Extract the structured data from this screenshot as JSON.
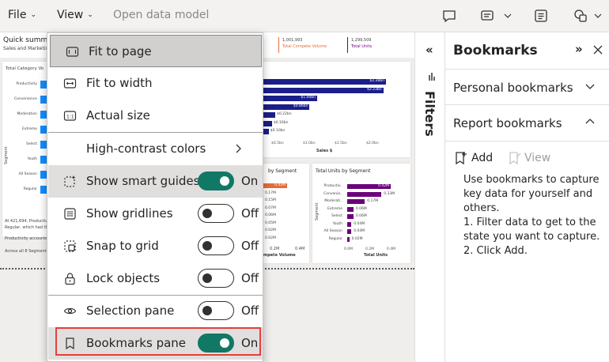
{
  "topbar": {
    "file_label": "File",
    "view_label": "View",
    "open_model_label": "Open data model"
  },
  "report": {
    "title": "Quick summar",
    "subtitle": "Sales and Marketin",
    "kpis": [
      {
        "value": "1,001,993",
        "label": "Total Compete Volume"
      },
      {
        "value": "1,299,509",
        "label": "Total Units"
      }
    ],
    "category_chart": {
      "title": "Total Category Vo",
      "ylabel": "Segment",
      "categories": [
        "Productivity",
        "Convenience",
        "Moderation",
        "Extreme",
        "Select",
        "Youth",
        "All Season",
        "Regular"
      ]
    },
    "sales_chart": {
      "bars": [
        {
          "label": "$2.28bn",
          "value": 2.28
        },
        {
          "label": "$2.23bn",
          "value": 2.23
        },
        {
          "label": "$1.00bn",
          "value": 1.0
        },
        {
          "label": "$0.86bn",
          "value": 0.86
        },
        {
          "label": "$0.22bn",
          "value": 0.22
        },
        {
          "label": "$0.16bn",
          "value": 0.16
        },
        {
          "label": "$0.10bn",
          "value": 0.1
        }
      ],
      "ticks": [
        "$0.5bn",
        "$1.0bn",
        "$1.5bn",
        "$2.0bn"
      ],
      "xlabel": "Sales $"
    },
    "compete_chart": {
      "title": "by Segment",
      "values": [
        "0.42M",
        "0.17M",
        "0.15M",
        "0.07M",
        "0.06M",
        "0.05M",
        "0.02M",
        "0.02M"
      ],
      "ticks": [
        "0.2M",
        "0.4M"
      ],
      "xlabel": "mpete Volume"
    },
    "units_chart": {
      "title": "Total Units by Segment",
      "ylabel": "Segment",
      "categories": [
        "Productiv..",
        "Convenie..",
        "Moderati..",
        "Extreme",
        "Select",
        "Youth",
        "All Season",
        "Regular"
      ],
      "values": [
        "0.42M",
        "0.33M",
        "0.17M",
        "0.06M",
        "0.06M",
        "0.04M",
        "0.04M",
        "0.02M"
      ],
      "ticks": [
        "0.0M",
        "0.2M",
        "0.4M"
      ],
      "xlabel": "Total Units"
    },
    "notes": [
      "At 421,694, Productiv",
      "Regular, which had the",
      "Productivity accounte",
      "Across all 8 Segment"
    ]
  },
  "menu": {
    "fit_page": "Fit to page",
    "fit_width": "Fit to width",
    "actual_size": "Actual size",
    "high_contrast": "High-contrast colors",
    "smart_guides": {
      "label": "Show smart guides",
      "state": "On"
    },
    "gridlines": {
      "label": "Show gridlines",
      "state": "Off"
    },
    "snap_grid": {
      "label": "Snap to grid",
      "state": "Off"
    },
    "lock_objects": {
      "label": "Lock objects",
      "state": "Off"
    },
    "selection_pane": {
      "label": "Selection pane",
      "state": "Off"
    },
    "bookmarks_pane": {
      "label": "Bookmarks pane",
      "state": "On"
    }
  },
  "filters": {
    "label": "Filters"
  },
  "bookmarks": {
    "title": "Bookmarks",
    "personal": "Personal bookmarks",
    "report": "Report bookmarks",
    "add_label": "Add",
    "view_label": "View",
    "description": "Use bookmarks to capture key data for yourself and others.",
    "step1": "1. Filter data to get to the state you want to capture.",
    "step2": "2. Click Add."
  },
  "colors": {
    "toggle_on": "#117865",
    "highlight": "#e3403e",
    "bar_blue": "#1b1f8a",
    "bar_cat": "#118dff",
    "bar_purple": "#6b007b",
    "bar_orange": "#e66c37"
  }
}
